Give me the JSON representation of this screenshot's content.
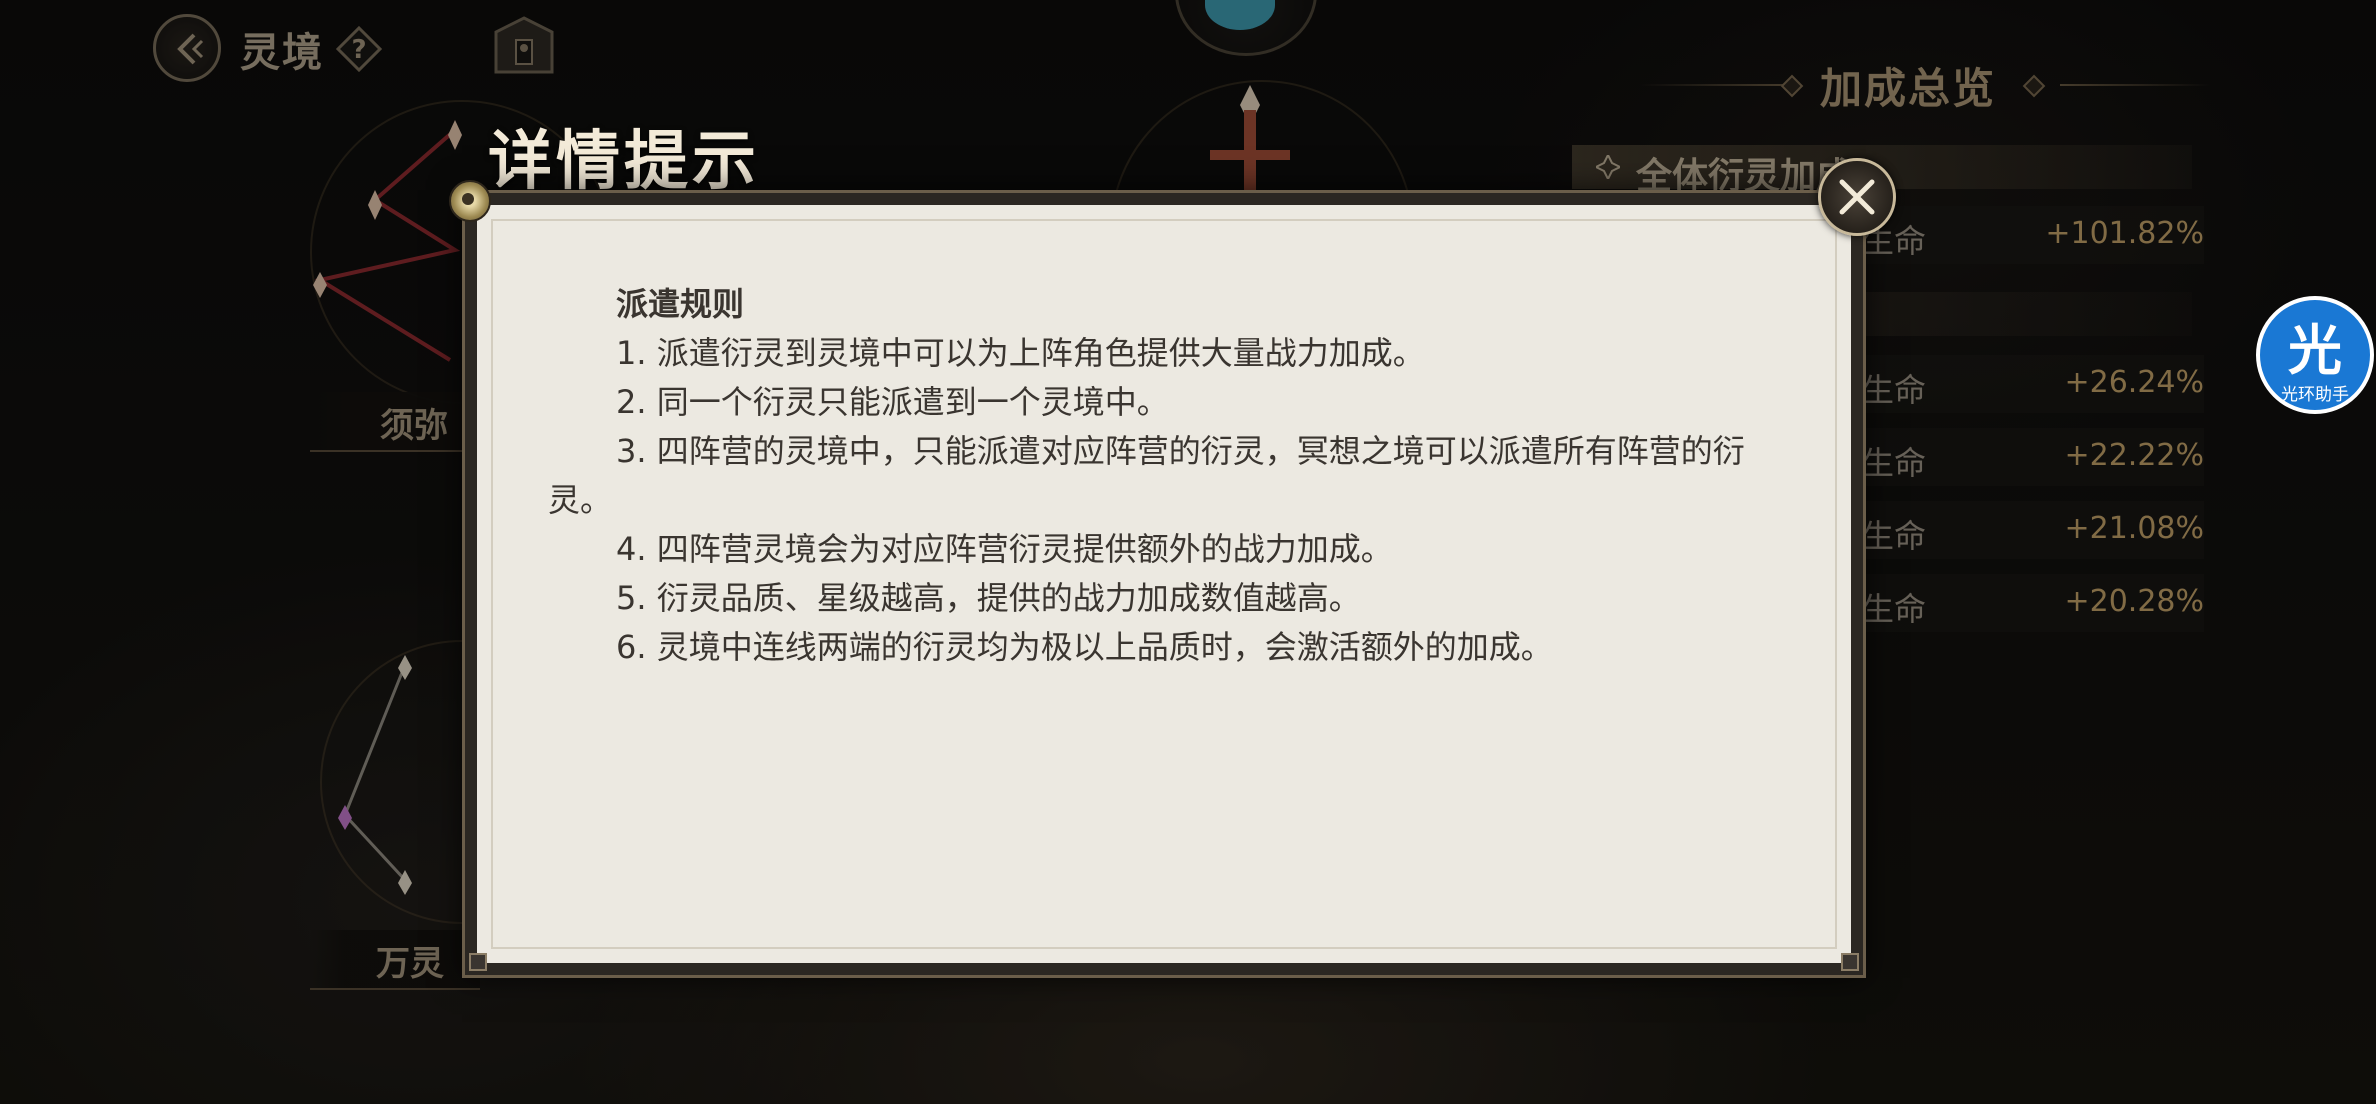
{
  "header": {
    "title": "灵境"
  },
  "overview": {
    "title": "加成总览",
    "group_title": "全体衍灵加成",
    "rows": [
      {
        "label": "生命",
        "value": "+101.82%"
      },
      {
        "label": "生命",
        "value": "+26.24%"
      },
      {
        "label": "生命",
        "value": "+22.22%"
      },
      {
        "label": "生命",
        "value": "+21.08%"
      },
      {
        "label": "生命",
        "value": "+20.28%"
      }
    ]
  },
  "realms": [
    {
      "label": "须弥"
    },
    {
      "label": "万灵"
    }
  ],
  "assistant": {
    "glyph": "光",
    "label": "光环助手"
  },
  "modal": {
    "title": "详情提示",
    "heading": "派遣规则",
    "lines": [
      "1. 派遣衍灵到灵境中可以为上阵角色提供大量战力加成。",
      "2. 同一个衍灵只能派遣到一个灵境中。",
      "3. 四阵营的灵境中，只能派遣对应阵营的衍灵，冥想之境可以派遣所有阵营的衍灵。",
      "4. 四阵营灵境会为对应阵营衍灵提供额外的战力加成。",
      "5. 衍灵品质、星级越高，提供的战力加成数值越高。",
      "6. 灵境中连线两端的衍灵均为极以上品质时，会激活额外的加成。"
    ]
  },
  "colors": {
    "accent_gold": "#c6a56b",
    "paper": "#ece9e1",
    "assistant_blue": "#1a78d4"
  }
}
